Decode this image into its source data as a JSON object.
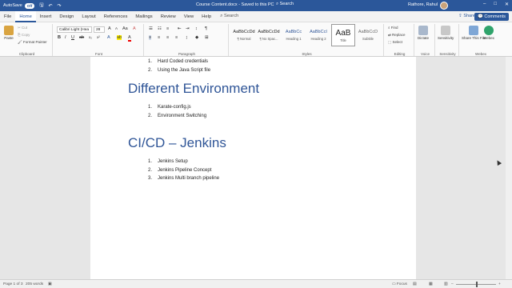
{
  "titlebar": {
    "autosave_label": "AutoSave",
    "autosave_state": "Off",
    "doc_title": "Course Content.docx  -  Saved to this PC",
    "search": "Search",
    "user": "Rathore, Rahul",
    "controls": [
      "–",
      "□",
      "✕"
    ]
  },
  "tabs": [
    "File",
    "Home",
    "Insert",
    "Design",
    "Layout",
    "References",
    "Mailings",
    "Review",
    "View",
    "Help"
  ],
  "tab_search": "Search",
  "share_label": "Share",
  "comments_label": "Comments",
  "ribbon": {
    "clipboard": {
      "paste": "Paste",
      "cut": "Cut",
      "copy": "Copy",
      "format_painter": "Format Painter",
      "label": "Clipboard"
    },
    "font": {
      "family": "Calibri Light (Hea",
      "size": "28",
      "label": "Font"
    },
    "paragraph": {
      "label": "Paragraph"
    },
    "styles": {
      "label": "Styles",
      "items": [
        {
          "sample": "AaBbCcDd",
          "name": "¶ Normal"
        },
        {
          "sample": "AaBbCcDd",
          "name": "¶ No Spac..."
        },
        {
          "sample": "AaBbCc",
          "name": "Heading 1"
        },
        {
          "sample": "AaBbCcI",
          "name": "Heading 2"
        },
        {
          "sample": "AaB",
          "name": "Title"
        },
        {
          "sample": "AaBbCcD",
          "name": "Subtitle"
        }
      ]
    },
    "editing": {
      "find": "Find",
      "replace": "Replace",
      "select": "Select",
      "label": "Editing"
    },
    "voice": {
      "dictate": "Dictate",
      "label": "Voice"
    },
    "sensitivity": {
      "sensitivity": "Sensitivity",
      "label": "Sensitivity"
    },
    "webex": {
      "share": "Share This File",
      "webex": "Webex",
      "label": "Webex"
    }
  },
  "document": {
    "list1": [
      {
        "num": "1.",
        "text": "Hard Coded credentials"
      },
      {
        "num": "2.",
        "text": "Using the Java Script file"
      }
    ],
    "heading1": "Different Environment",
    "list2": [
      {
        "num": "1.",
        "text": "Karate-config.js"
      },
      {
        "num": "2.",
        "text": "Environment Switching"
      }
    ],
    "heading2": "CI/CD – Jenkins",
    "list3": [
      {
        "num": "1.",
        "text": "Jenkins Setup"
      },
      {
        "num": "2.",
        "text": "Jenkins Pipeline Concept"
      },
      {
        "num": "3.",
        "text": "Jenkins Multi branch pipeline"
      }
    ]
  },
  "status": {
    "page": "Page 1 of 3",
    "words": "205 words",
    "focus": "Focus"
  },
  "colors": {
    "accent": "#2b579a",
    "heading": "#2f5597"
  }
}
